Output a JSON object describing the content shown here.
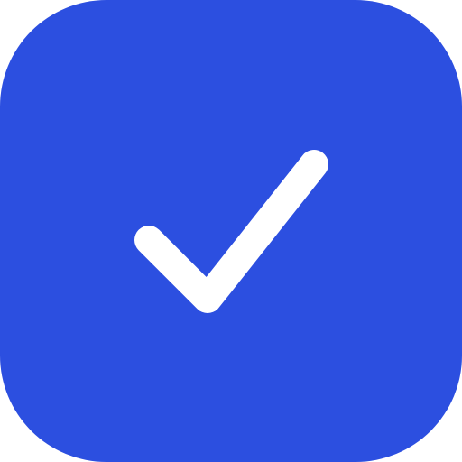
{
  "icon": {
    "name": "checkmark-icon",
    "background_color": "#2c4fe0",
    "glyph_color": "#ffffff"
  }
}
